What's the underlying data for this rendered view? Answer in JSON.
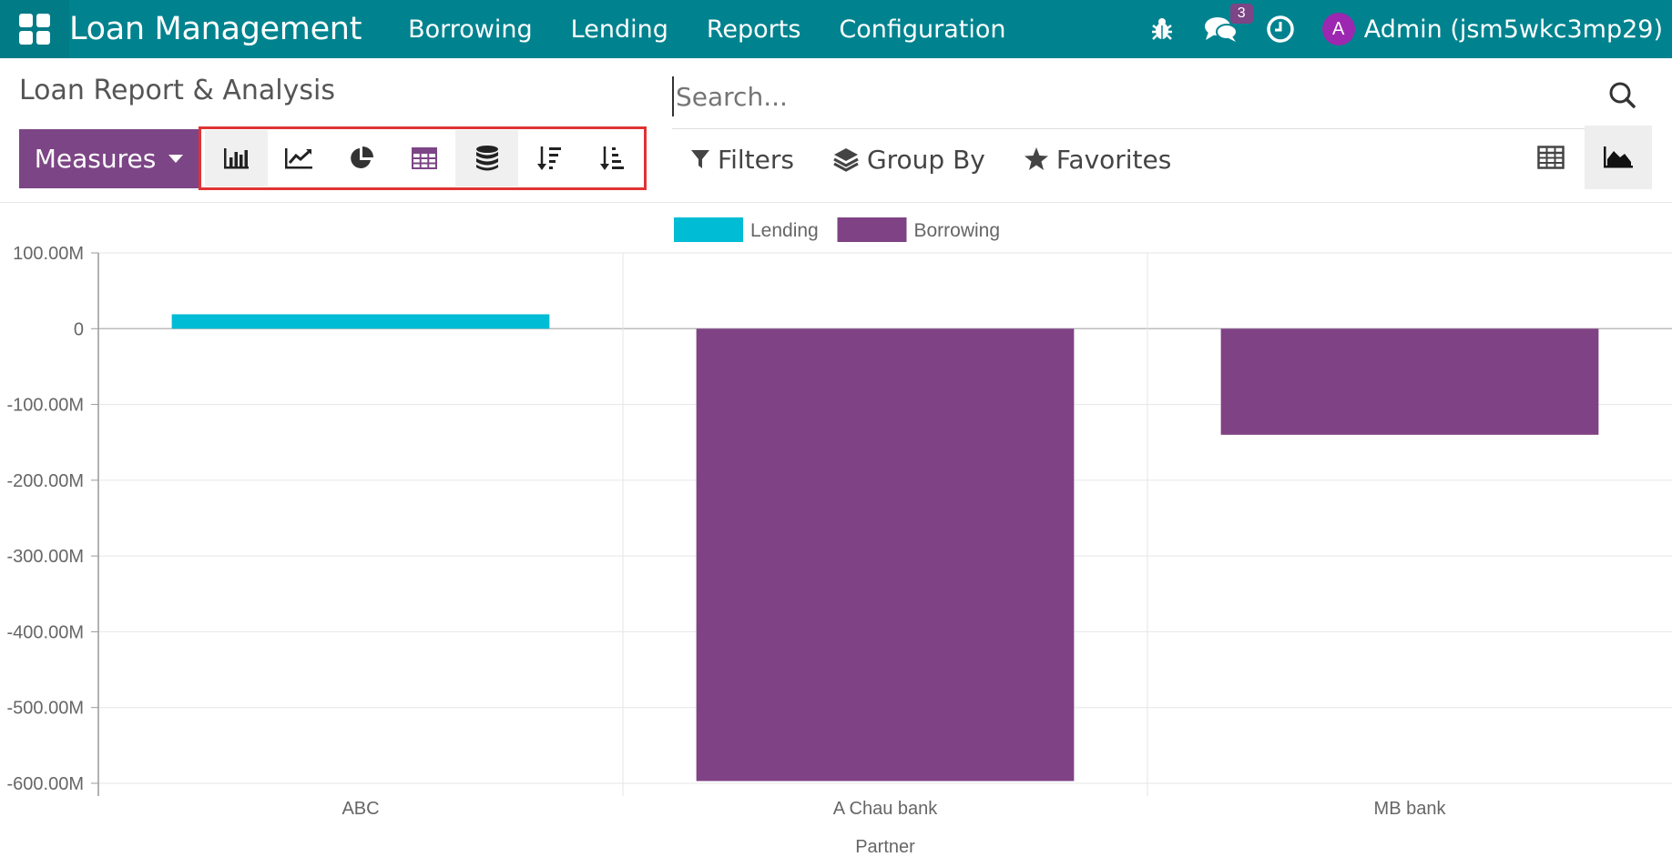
{
  "navbar": {
    "brand": "Loan Management",
    "menu": [
      "Borrowing",
      "Lending",
      "Reports",
      "Configuration"
    ],
    "messages_badge": "3",
    "avatar_letter": "A",
    "user": "Admin (jsm5wkc3mp29)"
  },
  "control_panel": {
    "title": "Loan Report & Analysis",
    "search_placeholder": "Search...",
    "measures_label": "Measures",
    "chart_tools": [
      "bar-chart-icon",
      "line-chart-icon",
      "pie-chart-icon",
      "table-icon",
      "stacked-icon",
      "sort-descending-icon",
      "sort-ascending-icon"
    ],
    "filters_label": "Filters",
    "groupby_label": "Group By",
    "favorites_label": "Favorites"
  },
  "colors": {
    "navbar": "#00838f",
    "accent": "#7c4585",
    "lending": "#00bcd4",
    "borrowing": "#7f4284"
  },
  "chart_data": {
    "type": "bar",
    "categories": [
      "ABC",
      "A Chau bank",
      "MB bank"
    ],
    "series": [
      {
        "name": "Lending",
        "values": [
          19000000,
          0,
          0
        ]
      },
      {
        "name": "Borrowing",
        "values": [
          0,
          -597000000,
          -140000000
        ]
      }
    ],
    "xlabel": "Partner",
    "ylabel": "",
    "ylim": [
      -600000000,
      100000000
    ],
    "yticks": [
      "100.00M",
      "0",
      "-100.00M",
      "-200.00M",
      "-300.00M",
      "-400.00M",
      "-500.00M",
      "-600.00M"
    ],
    "legend_position": "top-center",
    "grid": true
  }
}
